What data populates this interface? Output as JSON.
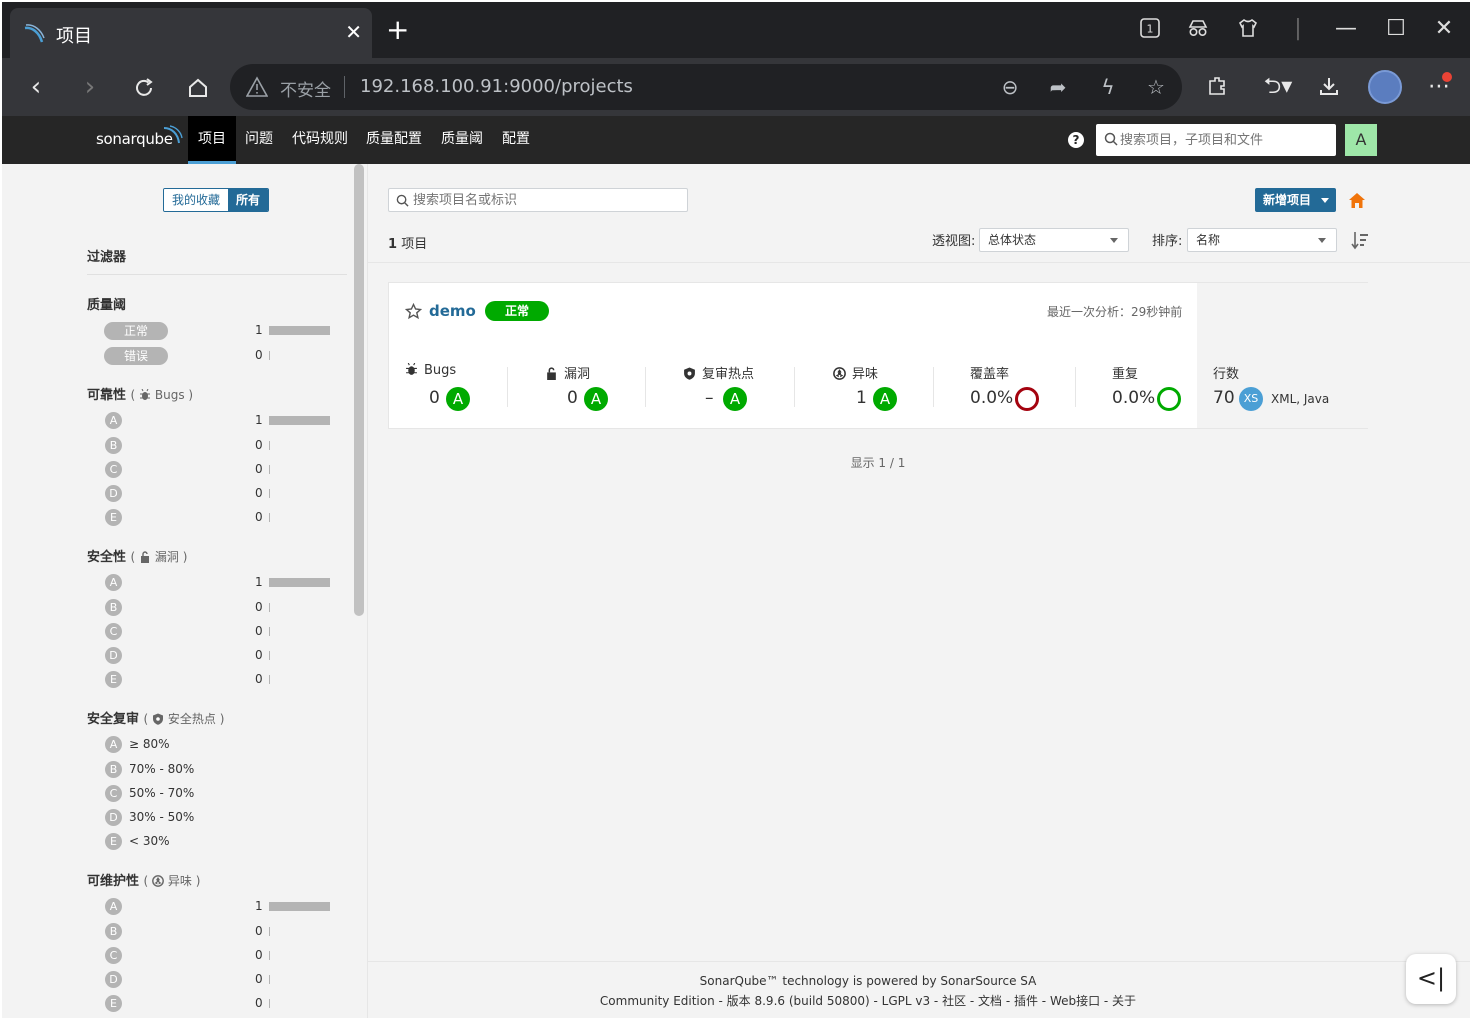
{
  "browser": {
    "tab_title": "项目",
    "tab_close": "✕",
    "new_tab": "+",
    "tab_count": "1",
    "insecure_label": "不安全",
    "url": "192.168.100.91:9000/projects"
  },
  "nav": {
    "logo_text": "sonarqube",
    "items": [
      {
        "label": "项目"
      },
      {
        "label": "问题"
      },
      {
        "label": "代码规则"
      },
      {
        "label": "质量配置"
      },
      {
        "label": "质量阈"
      },
      {
        "label": "配置"
      }
    ],
    "help": "?",
    "search_placeholder": "搜索项目，子项目和文件",
    "user_initial": "A"
  },
  "sidebar": {
    "toggle": {
      "favorites": "我的收藏",
      "all": "所有"
    },
    "filters_title": "过滤器",
    "quality_gate": {
      "title": "质量阈",
      "items": [
        {
          "label": "正常",
          "count": "1"
        },
        {
          "label": "错误",
          "count": "0"
        }
      ]
    },
    "reliability": {
      "title": "可靠性",
      "sub": "Bugs",
      "ratings": [
        {
          "grade": "A",
          "count": "1"
        },
        {
          "grade": "B",
          "count": "0"
        },
        {
          "grade": "C",
          "count": "0"
        },
        {
          "grade": "D",
          "count": "0"
        },
        {
          "grade": "E",
          "count": "0"
        }
      ]
    },
    "security": {
      "title": "安全性",
      "sub": "漏洞",
      "ratings": [
        {
          "grade": "A",
          "count": "1"
        },
        {
          "grade": "B",
          "count": "0"
        },
        {
          "grade": "C",
          "count": "0"
        },
        {
          "grade": "D",
          "count": "0"
        },
        {
          "grade": "E",
          "count": "0"
        }
      ]
    },
    "security_review": {
      "title": "安全复审",
      "sub": "安全热点",
      "ranges": [
        {
          "grade": "A",
          "label": "≥ 80%"
        },
        {
          "grade": "B",
          "label": "70% - 80%"
        },
        {
          "grade": "C",
          "label": "50% - 70%"
        },
        {
          "grade": "D",
          "label": "30% - 50%"
        },
        {
          "grade": "E",
          "label": "< 30%"
        }
      ]
    },
    "maintainability": {
      "title": "可维护性",
      "sub": "异味",
      "ratings": [
        {
          "grade": "A",
          "count": "1"
        },
        {
          "grade": "B",
          "count": "0"
        },
        {
          "grade": "C",
          "count": "0"
        },
        {
          "grade": "D",
          "count": "0"
        },
        {
          "grade": "E",
          "count": "0"
        }
      ]
    }
  },
  "main": {
    "search_placeholder": "搜索项目名或标识",
    "new_project": "新增项目",
    "project_count": "1",
    "project_count_unit": "项目",
    "perspective_label": "透视图:",
    "perspective_value": "总体状态",
    "sort_label": "排序:",
    "sort_value": "名称",
    "paging": "显示 1 / 1"
  },
  "project": {
    "name": "demo",
    "quality_gate": "正常",
    "last_analysis": "最近一次分析：29秒钟前",
    "metrics": {
      "bugs_label": "Bugs",
      "bugs_value": "0",
      "bugs_grade": "A",
      "vuln_label": "漏洞",
      "vuln_value": "0",
      "vuln_grade": "A",
      "hotspots_label": "复审热点",
      "hotspots_value": "–",
      "hotspots_grade": "A",
      "smells_label": "异味",
      "smells_value": "1",
      "smells_grade": "A",
      "coverage_label": "覆盖率",
      "coverage_value": "0.0%",
      "dup_label": "重复",
      "dup_value": "0.0%",
      "lines_label": "行数",
      "lines_value": "70",
      "size_badge": "XS",
      "languages": "XML, Java"
    }
  },
  "footer": {
    "line1": "SonarQube™ technology is powered by SonarSource SA",
    "line2": "Community Edition - 版本 8.9.6 (build 50800) - LGPL v3 - 社区 - 文档 - 插件 - Web接口 - 关于"
  },
  "colors": {
    "passed": "#00aa00",
    "primary": "#236a97",
    "coverage_ring": "#a4030f",
    "duplication_ring": "#00aa00",
    "size_badge": "#4b9fd5",
    "avatar": "#9ee6a8"
  }
}
